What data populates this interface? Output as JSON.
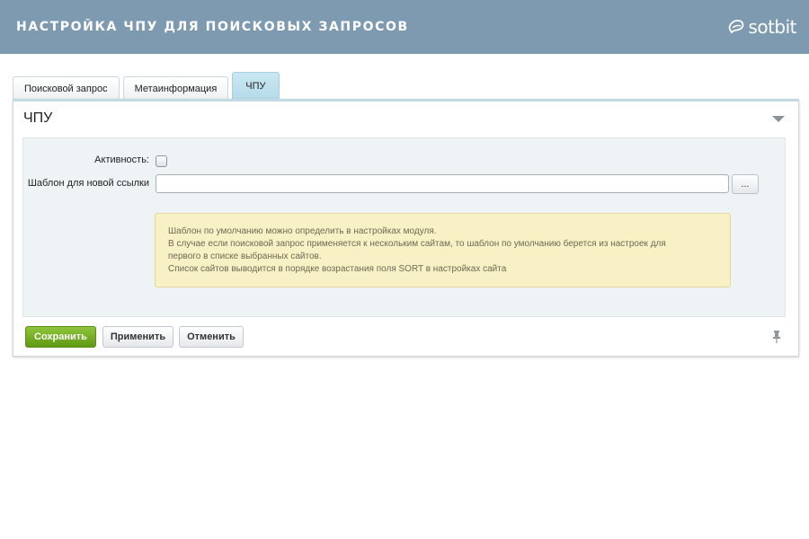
{
  "banner": {
    "title": "НАСТРОЙКА ЧПУ ДЛЯ ПОИСКОВЫХ ЗАПРОСОВ",
    "logo": "sotbit"
  },
  "tabs": [
    {
      "label": "Поисковой запрос",
      "active": false
    },
    {
      "label": "Метаинформация",
      "active": false
    },
    {
      "label": "ЧПУ",
      "active": true
    }
  ],
  "panel": {
    "title": "ЧПУ",
    "activity_label": "Активность:",
    "activity_checked": false,
    "template_label": "Шаблон для новой ссылки",
    "template_value": "",
    "browse_label": "...",
    "note_lines": [
      "Шаблон по умолчанию можно определить в настройках модуля.",
      "В случае если поисковой запрос применяется к нескольким сайтам, то шаблон по умолчанию берется из настроек для",
      "первого в списке выбранных сайтов.",
      "Список сайтов выводится в порядке возрастания поля SORT в настройках сайта"
    ]
  },
  "buttons": {
    "save": "Сохранить",
    "apply": "Применить",
    "cancel": "Отменить"
  },
  "colors": {
    "banner": "#7d9ab1",
    "save": "#6fab1f",
    "active_tab": "#bfe1ee",
    "note_bg": "#f8f1c6"
  }
}
